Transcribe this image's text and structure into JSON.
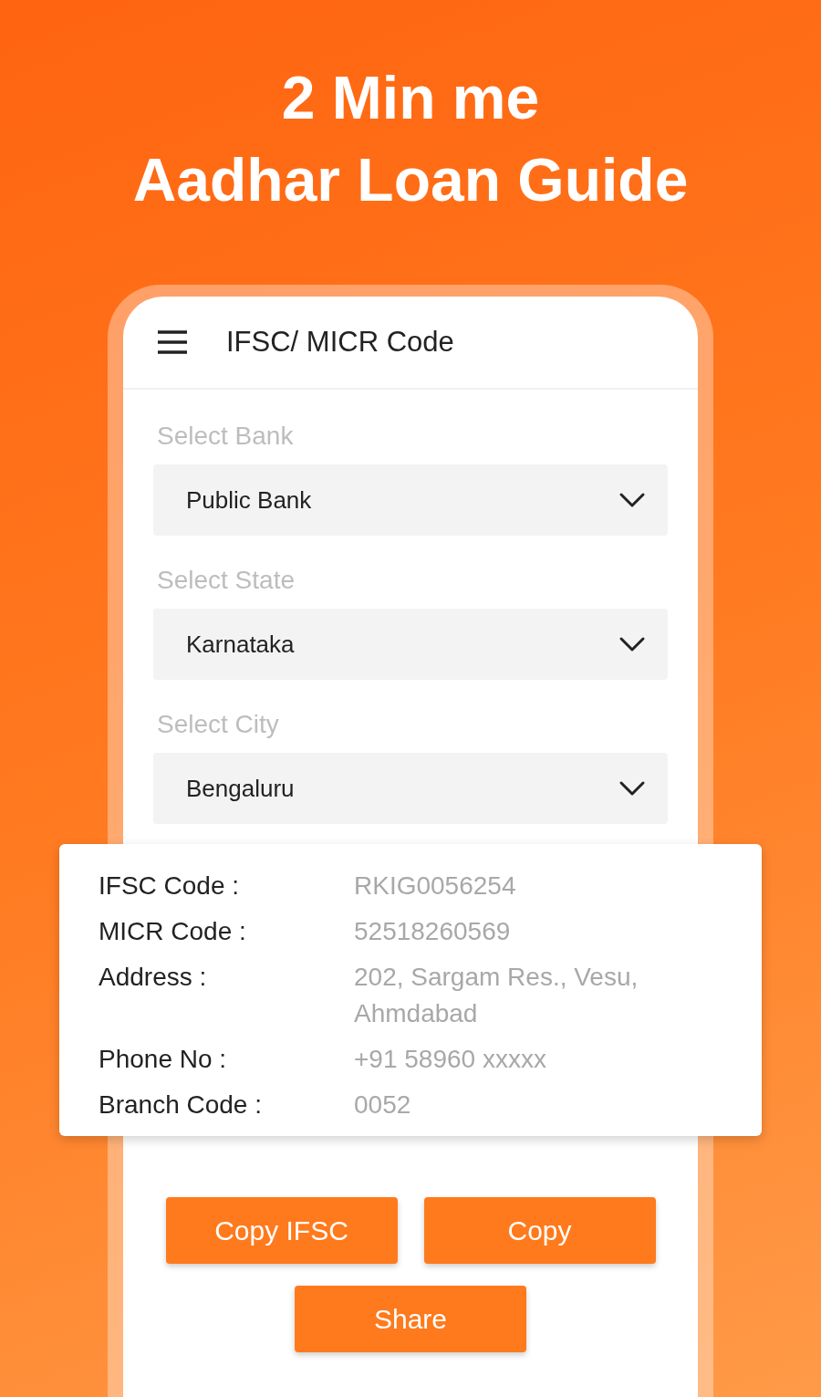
{
  "headline": {
    "line_1": "2 Min me",
    "line_2": "Aadhar Loan Guide"
  },
  "app_bar": {
    "title": "IFSC/ MICR Code"
  },
  "selects": [
    {
      "label": "Select Bank",
      "value": "Public Bank"
    },
    {
      "label": "Select State",
      "value": "Karnataka"
    },
    {
      "label": "Select City",
      "value": "Bengaluru"
    }
  ],
  "details": [
    {
      "label": "IFSC Code :",
      "value": "RKIG0056254"
    },
    {
      "label": "MICR Code :",
      "value": "52518260569"
    },
    {
      "label": "Address :",
      "value": "202, Sargam Res., Vesu, Ahmdabad"
    },
    {
      "label": "Phone No :",
      "value": "+91 58960 xxxxx"
    },
    {
      "label": "Branch Code :",
      "value": "0052"
    }
  ],
  "buttons": [
    {
      "label": "Copy IFSC"
    },
    {
      "label": "Copy"
    },
    {
      "label": "Share"
    }
  ]
}
